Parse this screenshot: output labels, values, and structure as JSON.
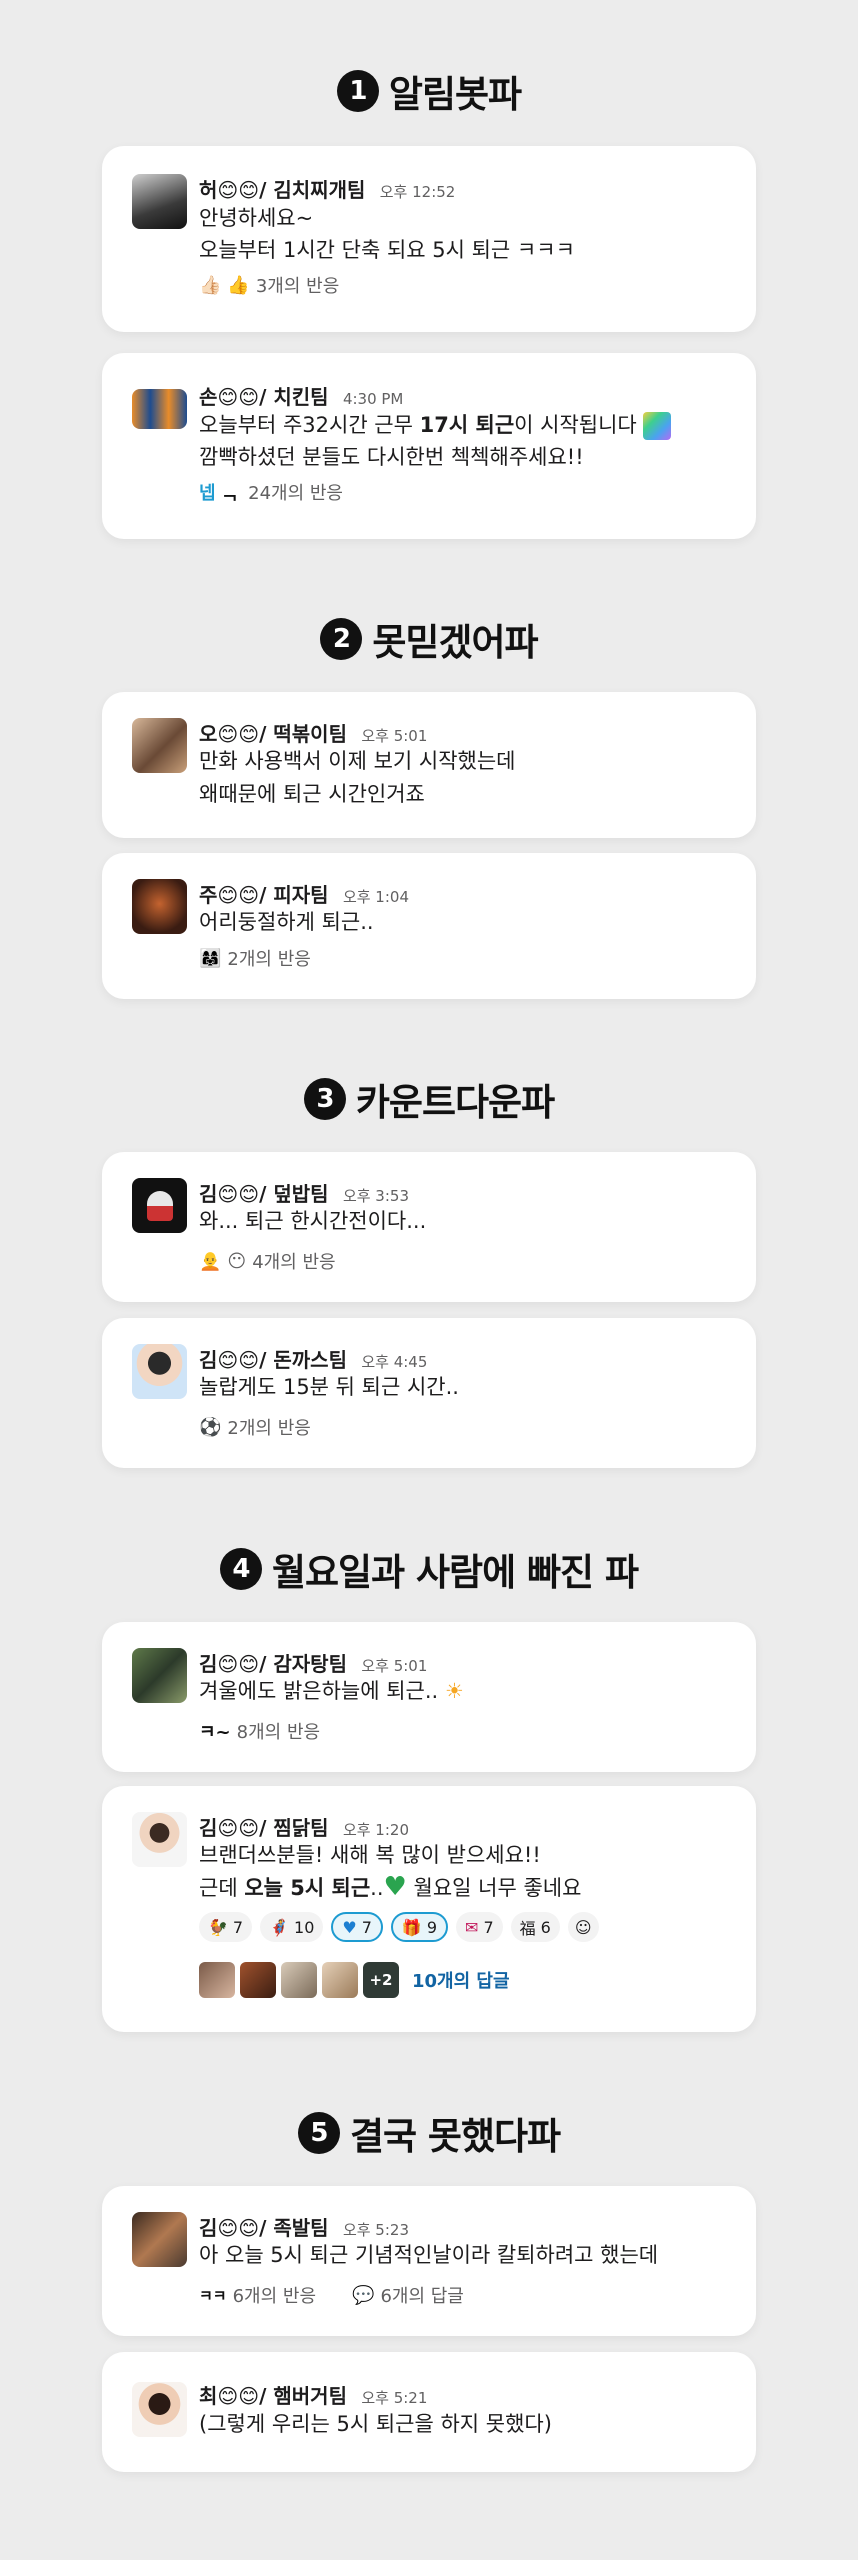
{
  "sections": [
    {
      "num": "1",
      "title": "알림봇파"
    },
    {
      "num": "2",
      "title": "못믿겠어파"
    },
    {
      "num": "3",
      "title": "카운트다운파"
    },
    {
      "num": "4",
      "title": "월요일과 사람에 빠진 파"
    },
    {
      "num": "5",
      "title": "결국 못했다파"
    }
  ],
  "messages": [
    {
      "name": "허😊😊/ 김치찌개팀",
      "time": "오후 12:52",
      "lines": [
        "안녕하세요~",
        "오늘부터 1시간 단축 되요 5시 퇴근 ㅋㅋㅋ"
      ],
      "reactions": "3개의 반응"
    },
    {
      "name": "손😊😊/ 치킨팀",
      "time": "4:30 PM",
      "lines": [
        "오늘부터 주32시간 근무 ",
        "17시 퇴근",
        "이 시작됩니다",
        "깜빡하셨던 분들도 다시한번 첵첵해주세요!!"
      ],
      "reaction_prefix": "넵",
      "reactions": "24개의 반응"
    },
    {
      "name": "오😊😊/ 떡볶이팀",
      "time": "오후 5:01",
      "lines": [
        "만화 사용백서 이제 보기 시작했는데",
        "왜때문에 퇴근 시간인거죠"
      ]
    },
    {
      "name": "주😊😊/ 피자팀",
      "time": "오후 1:04",
      "lines": [
        "어리둥절하게 퇴근.."
      ],
      "reactions": "2개의 반응"
    },
    {
      "name": "김😊😊/ 덮밥팀",
      "time": "오후 3:53",
      "lines": [
        "와... 퇴근 한시간전이다..."
      ],
      "reactions": "4개의 반응"
    },
    {
      "name": "김😊😊/ 돈까스팀",
      "time": "오후 4:45",
      "lines": [
        "놀랍게도 15분 뒤 퇴근 시간.."
      ],
      "reactions": "2개의 반응"
    },
    {
      "name": "김😊😊/ 감자탕팀",
      "time": "오후 5:01",
      "lines": [
        "겨울에도 밝은하늘에 퇴근.."
      ],
      "reaction_prefix": "ㅋ~",
      "reactions": "8개의 반응"
    },
    {
      "name": "김😊😊/ 찜닭팀",
      "time": "오후 1:20",
      "lines": [
        "브랜더쓰분들! 새해 복 많이 받으세요!!",
        "근데 ",
        "오늘 5시 퇴근",
        "..",
        "월요일 너무 좋네요"
      ],
      "chips": [
        "7",
        "10",
        "7",
        "9",
        "7",
        "6"
      ],
      "chip_glyphs": [
        "福"
      ],
      "more": "+2",
      "replies": "10개의 답글"
    },
    {
      "name": "김😊😊/ 족발팀",
      "time": "오후 5:23",
      "lines": [
        "아 오늘 5시 퇴근 기념적인날이라 칼퇴하려고 했는데"
      ],
      "reaction_prefix": "ㅋㅋ",
      "reactions": "6개의 반응",
      "replies": "6개의 답글"
    },
    {
      "name": "최😊😊/ 햄버거팀",
      "time": "오후 5:21",
      "lines": [
        "(그렇게 우리는 5시 퇴근을 하지 못했다)"
      ]
    }
  ],
  "colors": {
    "background": "#ececec",
    "card": "#ffffff",
    "link": "#1264a3",
    "selected_chip": "#1d9bd1",
    "heart": "#2aa44f"
  }
}
